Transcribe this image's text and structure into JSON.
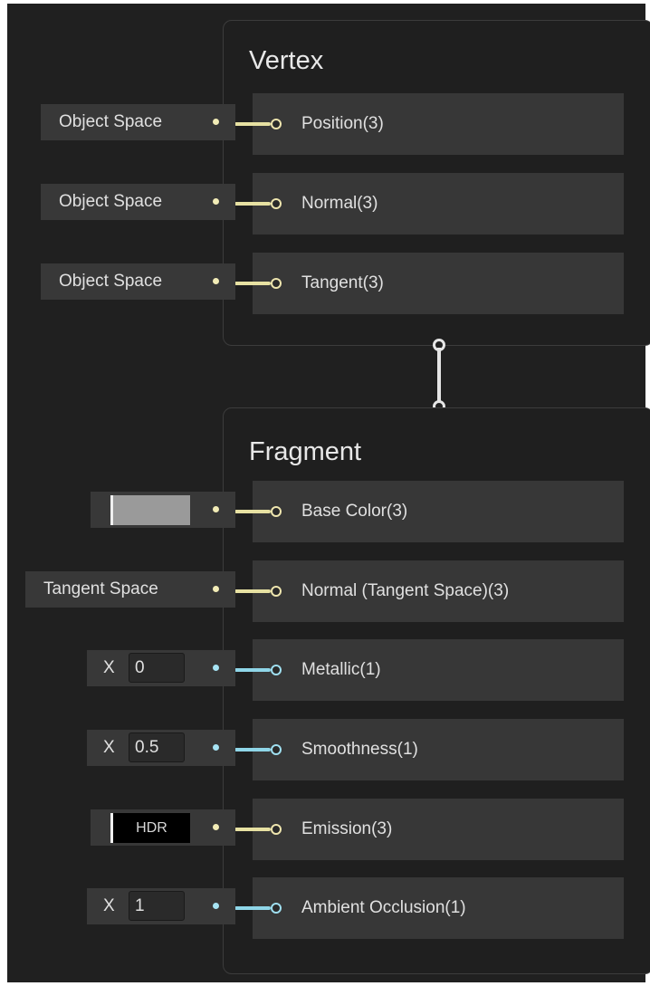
{
  "vertex": {
    "title": "Vertex",
    "slots": [
      {
        "label": "Position(3)",
        "input": "Object Space"
      },
      {
        "label": "Normal(3)",
        "input": "Object Space"
      },
      {
        "label": "Tangent(3)",
        "input": "Object Space"
      }
    ]
  },
  "fragment": {
    "title": "Fragment",
    "slots": [
      {
        "label": "Base Color(3)",
        "input_type": "color-swatch"
      },
      {
        "label": "Normal (Tangent Space)(3)",
        "input": "Tangent Space"
      },
      {
        "label": "Metallic(1)",
        "axis": "X",
        "value": "0"
      },
      {
        "label": "Smoothness(1)",
        "axis": "X",
        "value": "0.5"
      },
      {
        "label": "Emission(3)",
        "input_type": "hdr-swatch",
        "hdr_label": "HDR"
      },
      {
        "label": "Ambient Occlusion(1)",
        "axis": "X",
        "value": "1"
      }
    ]
  },
  "colors": {
    "background": "#202020",
    "block_border": "#3c3c3c",
    "slot_bg": "#373737",
    "vector3_port": "#eee5ae",
    "vector1_port": "#9fdff0",
    "base_color_swatch": "#9a9a9a",
    "emission_swatch": "#000000"
  },
  "icons": {
    "vector3_port": "port-circle-icon",
    "vector1_port": "port-circle-icon",
    "block_link": "connector-icon"
  }
}
